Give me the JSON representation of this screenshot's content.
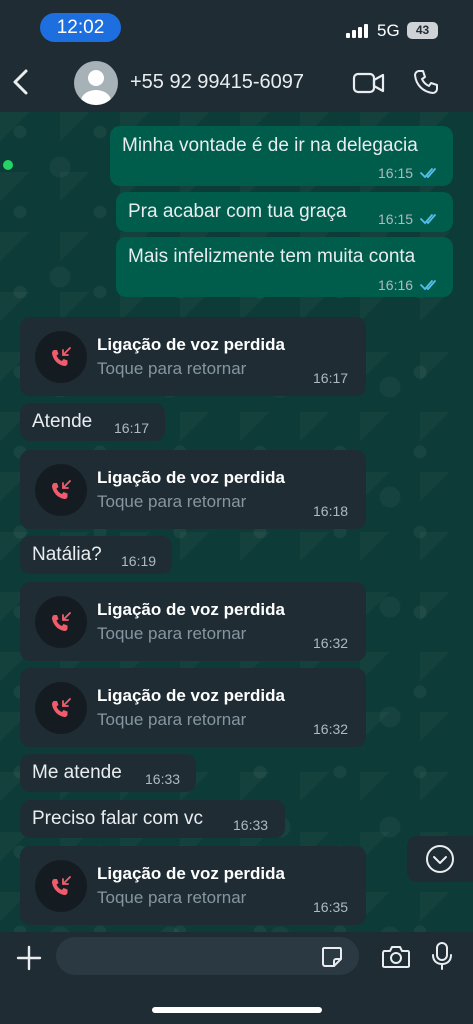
{
  "status_bar": {
    "time": "12:02",
    "network": "5G",
    "battery": "43"
  },
  "header": {
    "contact": "+55 92 99415-6097"
  },
  "messages": [
    {
      "text": "Minha vontade é de ir na delegacia",
      "time": "16:15"
    },
    {
      "text": "Pra acabar com tua graça",
      "time": "16:15"
    },
    {
      "text": "Mais infelizmente tem muita conta",
      "time": "16:16"
    },
    {
      "text": "Atende",
      "time": "16:17"
    },
    {
      "text": "Natália?",
      "time": "16:19"
    },
    {
      "text": "Me atende",
      "time": "16:33"
    },
    {
      "text": "Preciso falar com vc",
      "time": "16:33"
    }
  ],
  "calls": [
    {
      "title": "Ligação de voz perdida",
      "subtitle": "Toque para retornar",
      "time": "16:17"
    },
    {
      "title": "Ligação de voz perdida",
      "subtitle": "Toque para retornar",
      "time": "16:18"
    },
    {
      "title": "Ligação de voz perdida",
      "subtitle": "Toque para retornar",
      "time": "16:32"
    },
    {
      "title": "Ligação de voz perdida",
      "subtitle": "Toque para retornar",
      "time": "16:32"
    },
    {
      "title": "Ligação de voz perdida",
      "subtitle": "Toque para retornar",
      "time": "16:35"
    }
  ],
  "icons": {
    "back": "chevron-left-icon",
    "video": "video-call-icon",
    "phone": "phone-icon",
    "missed_call": "missed-call-icon",
    "read_receipt": "double-check-icon",
    "scroll_down": "chevron-down-circle-icon",
    "plus": "plus-icon",
    "sticker": "sticker-icon",
    "camera": "camera-icon",
    "mic": "microphone-icon"
  },
  "colors": {
    "outgoing_bubble": "#005c4b",
    "incoming_bubble": "#1f2c34",
    "read_ticks": "#53bdeb",
    "missed_call_red": "#f15c6d",
    "online": "#25d366",
    "time_pill": "#1d6fe0"
  }
}
